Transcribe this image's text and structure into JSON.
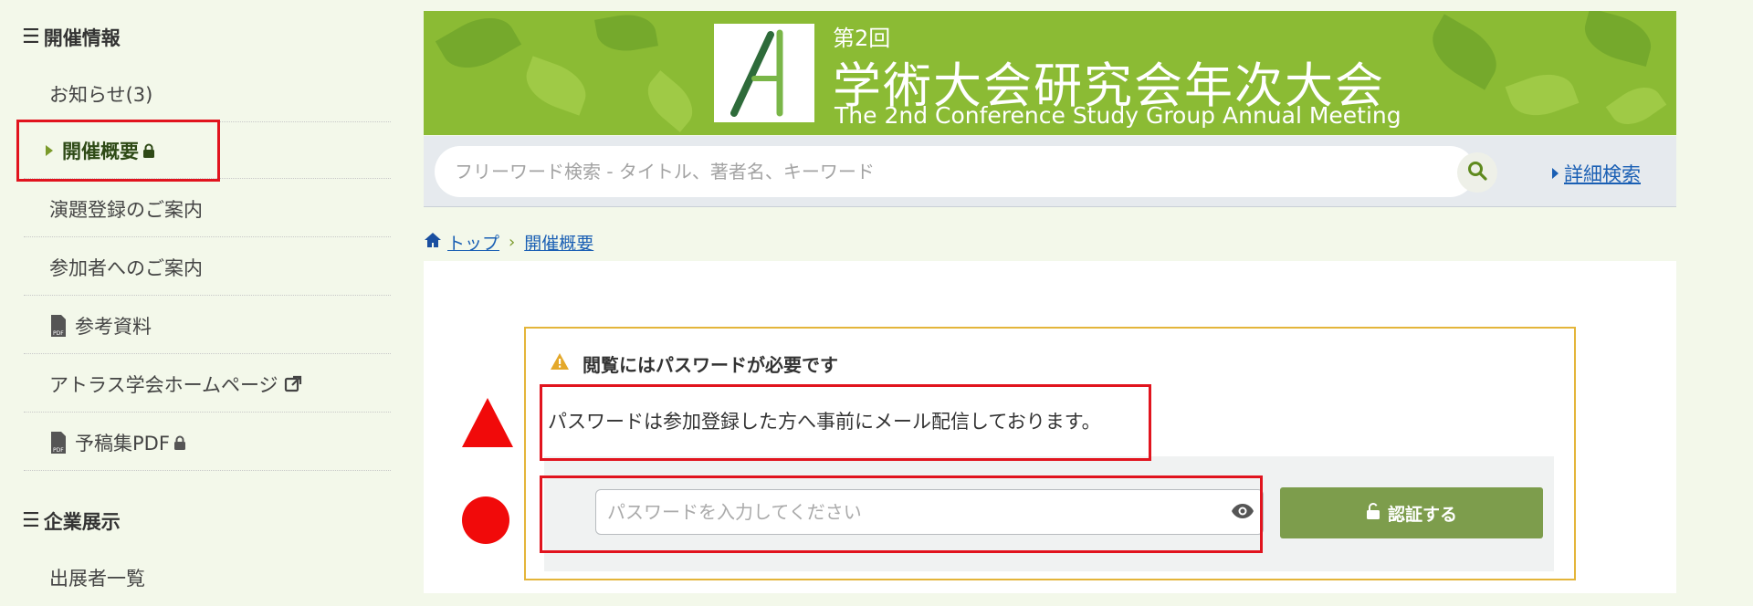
{
  "sidebar": {
    "section1": {
      "title": "開催情報"
    },
    "items": [
      {
        "label": "お知らせ(3)"
      },
      {
        "label": "開催概要"
      },
      {
        "label": "演題登録のご案内"
      },
      {
        "label": "参加者へのご案内"
      },
      {
        "label": "参考資料"
      },
      {
        "label": "アトラス学会ホームページ"
      },
      {
        "label": "予稿集PDF"
      }
    ],
    "section2": {
      "title": "企業展示"
    },
    "items2": [
      {
        "label": "出展者一覧"
      }
    ]
  },
  "banner": {
    "small": "第2回",
    "title": "学術大会研究会年次大会",
    "subtitle": "The 2nd Conference Study Group Annual Meeting"
  },
  "search": {
    "placeholder": "フリーワード検索 - タイトル、著者名、キーワード",
    "advanced_label": "詳細検索"
  },
  "breadcrumb": {
    "home": "トップ",
    "current": "開催概要"
  },
  "notice": {
    "title": "閲覧にはパスワードが必要です",
    "message": "パスワードは参加登録した方へ事前にメール配信しております。",
    "password_placeholder": "パスワードを入力してください",
    "submit_label": "認証する"
  },
  "colors": {
    "accent_green": "#7d9d4c",
    "banner_green": "#8bbb34",
    "link_blue": "#1a5fb4",
    "highlight_red": "#e1141e",
    "warning_amber": "#e4b53a"
  }
}
